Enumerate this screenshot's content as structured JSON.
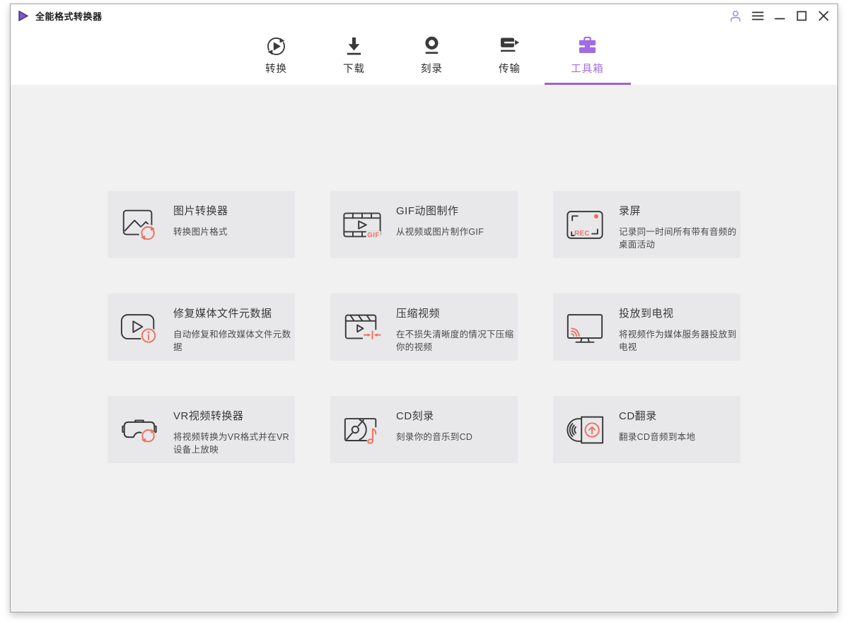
{
  "app": {
    "title": "全能格式转换器"
  },
  "titlebar": {
    "controls": [
      "account",
      "menu",
      "minimize",
      "maximize",
      "close"
    ]
  },
  "nav": {
    "tabs": [
      {
        "id": "convert",
        "label": "转换",
        "active": false
      },
      {
        "id": "download",
        "label": "下载",
        "active": false
      },
      {
        "id": "burn",
        "label": "刻录",
        "active": false
      },
      {
        "id": "transfer",
        "label": "传输",
        "active": false
      },
      {
        "id": "toolbox",
        "label": "工具箱",
        "active": true
      }
    ]
  },
  "toolbox": {
    "cards": [
      {
        "icon": "image-converter-icon",
        "title": "图片转换器",
        "description": "转换图片格式"
      },
      {
        "icon": "gif-maker-icon",
        "title": "GIF动图制作",
        "description": "从视频或图片制作GIF"
      },
      {
        "icon": "screen-recorder-icon",
        "title": "录屏",
        "description": "记录同一时间所有带有音频的桌面活动"
      },
      {
        "icon": "fix-metadata-icon",
        "title": "修复媒体文件元数据",
        "description": "自动修复和修改媒体文件元数据"
      },
      {
        "icon": "video-compressor-icon",
        "title": "压缩视频",
        "description": "在不损失清晰度的情况下压缩你的视频"
      },
      {
        "icon": "cast-to-tv-icon",
        "title": "投放到电视",
        "description": "将视频作为媒体服务器投放到电视"
      },
      {
        "icon": "vr-converter-icon",
        "title": "VR视频转换器",
        "description": "将视频转换为VR格式并在VR设备上放映"
      },
      {
        "icon": "cd-burner-icon",
        "title": "CD刻录",
        "description": "刻录你的音乐到CD"
      },
      {
        "icon": "cd-ripper-icon",
        "title": "CD翻录",
        "description": "翻录CD音频到本地"
      }
    ]
  },
  "icon_texts": {
    "gif": "GIF",
    "rec": "REC"
  },
  "colors": {
    "accent_purple": "#a16ce2",
    "underline_purple": "#9a63d8",
    "accent_coral": "#f0705e",
    "icon_dark": "#3a3a3c",
    "card_bg": "#e8e8ea",
    "content_bg": "#f1f1f2"
  }
}
